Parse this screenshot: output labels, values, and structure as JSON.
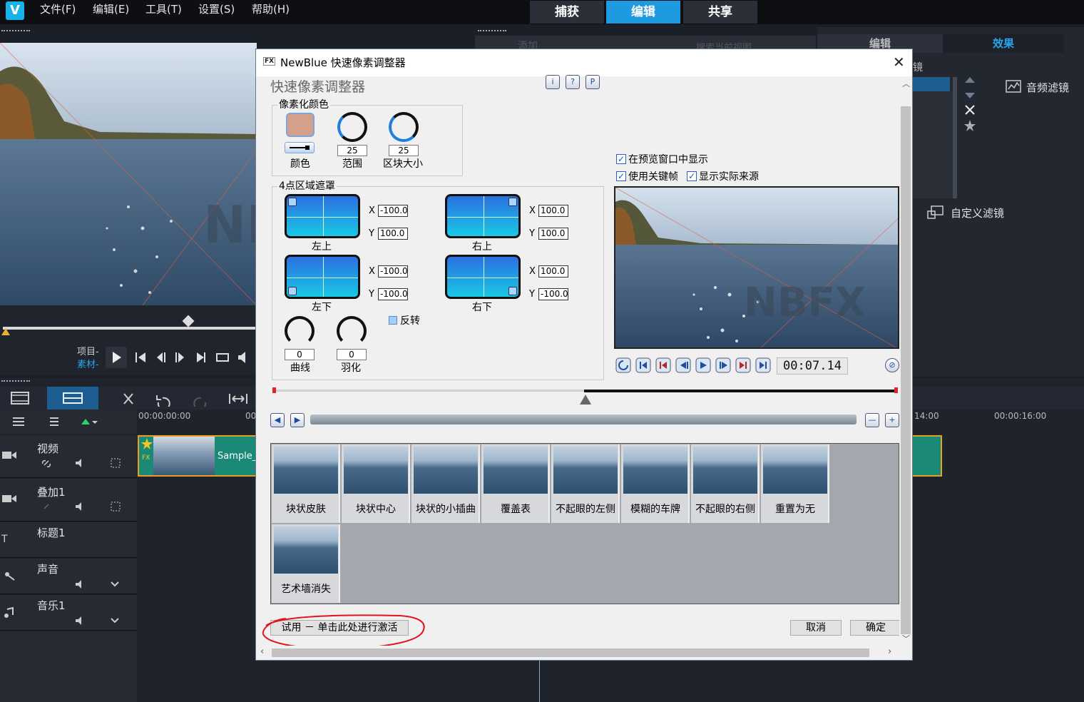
{
  "menu": [
    "文件(F)",
    "编辑(E)",
    "工具(T)",
    "设置(S)",
    "帮助(H)"
  ],
  "steps": [
    {
      "label": "捕获",
      "active": false
    },
    {
      "label": "编辑",
      "active": true
    },
    {
      "label": "共享",
      "active": false
    }
  ],
  "library": {
    "add_label": "添加",
    "search_placeholder": "搜索当前视图"
  },
  "right_panel": {
    "tabs": [
      "编辑",
      "效果"
    ],
    "partial_label": "镜",
    "audio_filter": "音频滤镜",
    "custom_filter": "自定义滤镜"
  },
  "player": {
    "project_label": "项目-",
    "clip_label": "素材-"
  },
  "timeline": {
    "times": [
      "00:00:00:00",
      "00",
      "14:00",
      "00:00:16:00"
    ],
    "tracks": [
      "视频",
      "叠加1",
      "标题1",
      "声音",
      "音乐1"
    ],
    "clip_label": "Sample_"
  },
  "dialog": {
    "title": "NewBlue 快速像素调整器",
    "heading": "快速像素调整器",
    "info_buttons": [
      "i",
      "?",
      "P"
    ],
    "pixel_color": {
      "group_title": "像素化颜色",
      "color_label": "颜色",
      "swatch_color": "#d4a08a",
      "range_label": "范围",
      "range_value": "25",
      "block_label": "区块大小",
      "block_value": "25"
    },
    "mask": {
      "group_title": "4点区域遮罩",
      "corners": [
        {
          "label": "左上",
          "x": "-100.0",
          "y": "100.0"
        },
        {
          "label": "右上",
          "x": "100.0",
          "y": "100.0"
        },
        {
          "label": "左下",
          "x": "-100.0",
          "y": "-100.0"
        },
        {
          "label": "右下",
          "x": "100.0",
          "y": "-100.0"
        }
      ],
      "curve_label": "曲线",
      "curve_value": "0",
      "feather_label": "羽化",
      "feather_value": "0",
      "invert_label": "反转"
    },
    "options": {
      "show_in_preview": "在预览窗口中显示",
      "use_keyframes": "使用关键帧",
      "show_source": "显示实际来源"
    },
    "preview_watermark": "NBFX",
    "timecode": "00:07.14",
    "presets": [
      "块状皮肤",
      "块状中心",
      "块状的小插曲",
      "覆盖表",
      "不起眼的左侧",
      "模糊的车牌",
      "不起眼的右侧",
      "重置为无",
      "艺术墙消失"
    ],
    "trial_button": "试用 － 单击此处进行激活",
    "cancel_button": "取消",
    "ok_button": "确定"
  },
  "colors": {
    "accent": "#1e9ae0",
    "annotation": "#e0141e"
  }
}
